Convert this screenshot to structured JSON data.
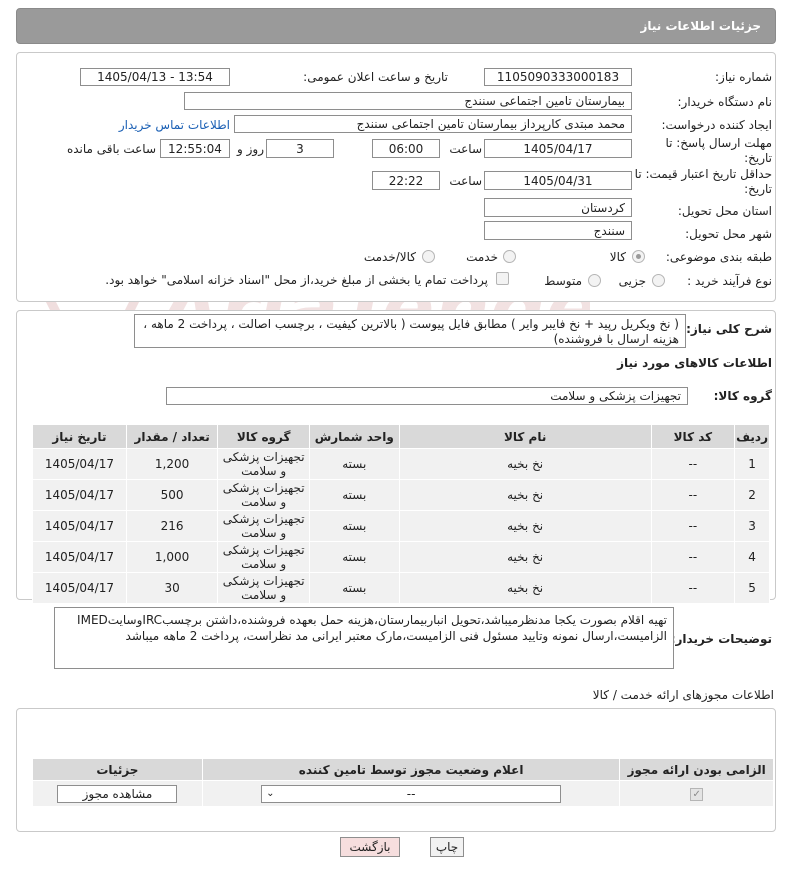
{
  "header": {
    "title": "جزئیات اطلاعات نیاز"
  },
  "fields": {
    "need_number_label": "شماره نیاز:",
    "need_number": "1105090333000183",
    "announce_label": "تاریخ و ساعت اعلان عمومی:",
    "announce_value": "1405/04/13 - 13:54",
    "buyer_org_label": "نام دستگاه خریدار:",
    "buyer_org": "بیمارستان تامین اجتماعی سنندج",
    "creator_label": "ایجاد کننده درخواست:",
    "creator": "محمد مبتدی کارپرداز بیمارستان تامین اجتماعی سنندج",
    "contact_link": "اطلاعات تماس خریدار",
    "reply_deadline_label": "مهلت ارسال پاسخ: تا تاریخ:",
    "reply_date": "1405/04/17",
    "time_label": "ساعت",
    "reply_time": "06:00",
    "days": "3",
    "days_label": "روز و",
    "remaining_time": "12:55:04",
    "remaining_label": "ساعت باقی مانده",
    "price_validity_label": "حداقل تاریخ اعتبار قیمت: تا تاریخ:",
    "price_date": "1405/04/31",
    "price_time": "22:22",
    "province_label": "استان محل تحویل:",
    "province": "کردستان",
    "city_label": "شهر محل تحویل:",
    "city": "سنندج",
    "category_label": "طبقه بندی موضوعی:",
    "category_options": [
      "کالا",
      "خدمت",
      "کالا/خدمت"
    ],
    "process_label": "نوع فرآیند خرید :",
    "process_options": [
      "جزیی",
      "متوسط"
    ],
    "treasury_note": "پرداخت تمام یا بخشی از مبلغ خرید،از محل \"اسناد خزانه اسلامی\" خواهد بود."
  },
  "description": {
    "label": "شرح کلی نیاز:",
    "text": "( نخ ویکریل رپید + نخ فایبر وایر ) مطابق فایل پیوست ( بالاترین کیفیت ، برچسب اصالت ، پرداخت 2 ماهه ، هزینه ارسال با فروشنده)"
  },
  "goods_section": {
    "title": "اطلاعات کالاهای مورد نیاز",
    "group_label": "گروه کالا:",
    "group_value": "تجهیزات پزشکی و سلامت"
  },
  "items_table": {
    "headers": [
      "ردیف",
      "کد کالا",
      "نام کالا",
      "واحد شمارش",
      "گروه کالا",
      "تعداد / مقدار",
      "تاریخ نیاز"
    ],
    "rows": [
      [
        "1",
        "--",
        "نخ بخیه",
        "بسته",
        "تجهیزات پزشکی و سلامت",
        "1,200",
        "1405/04/17"
      ],
      [
        "2",
        "--",
        "نخ بخیه",
        "بسته",
        "تجهیزات پزشکی و سلامت",
        "500",
        "1405/04/17"
      ],
      [
        "3",
        "--",
        "نخ بخیه",
        "بسته",
        "تجهیزات پزشکی و سلامت",
        "216",
        "1405/04/17"
      ],
      [
        "4",
        "--",
        "نخ بخیه",
        "بسته",
        "تجهیزات پزشکی و سلامت",
        "1,000",
        "1405/04/17"
      ],
      [
        "5",
        "--",
        "نخ بخیه",
        "بسته",
        "تجهیزات پزشکی و سلامت",
        "30",
        "1405/04/17"
      ]
    ]
  },
  "buyer_notes": {
    "label": "توضیحات خریدار:",
    "text": "تهیه اقلام بصورت یکجا مدنظرمیباشد،تحویل انباربیمارستان،هزینه حمل بعهده فروشنده،داشتن برچسبIRCوسایتIMED الزامیست،ارسال نمونه وتایید مسئول فنی الزامیست،مارک معتبر ایرانی مد نظراست، پرداخت 2 ماهه میباشد"
  },
  "license_section": {
    "title": "اطلاعات مجوزهای ارائه خدمت / کالا",
    "headers": [
      "الزامی بودن ارائه مجوز",
      "اعلام وضعیت مجوز توسط تامین کننده",
      "جزئیات"
    ],
    "select_value": "--",
    "view_button": "مشاهده مجوز"
  },
  "buttons": {
    "print": "چاپ",
    "back": "بازگشت"
  },
  "watermark": "AriaTender.net",
  "colors": {
    "header_bg": "#9a9a9a",
    "link": "#1a5fb4",
    "back_button_bg": "#f6dede",
    "watermark": "#f0dede"
  }
}
